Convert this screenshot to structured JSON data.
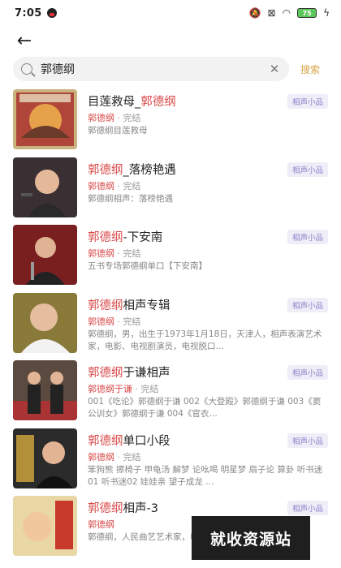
{
  "status": {
    "time": "7:05",
    "battery": "75"
  },
  "search": {
    "query": "郭德纲",
    "button_label": "搜索",
    "clear": "✕"
  },
  "results": [
    {
      "title_pre": "目莲救母_",
      "title_hl": "郭德纲",
      "title_post": "",
      "author": "郭德纲",
      "status": " · 完结",
      "desc": "郭德纲目莲救母",
      "tag": "相声小品"
    },
    {
      "title_pre": "",
      "title_hl": "郭德纲",
      "title_post": "_落榜艳遇",
      "author": "郭德纲",
      "status": " · 完结",
      "desc": "郭德纲相声：落榜艳遇",
      "tag": "相声小品"
    },
    {
      "title_pre": "",
      "title_hl": "郭德纲",
      "title_post": "-下安南",
      "author": "郭德纲",
      "status": " · 完结",
      "desc": "五书专场郭德纲单口【下安南】",
      "tag": "相声小品"
    },
    {
      "title_pre": "",
      "title_hl": "郭德纲",
      "title_post": "相声专辑",
      "author": "郭德纲",
      "status": " · 完结",
      "desc": "郭德纲，男，出生于1973年1月18日，天津人，相声表演艺术家，电影、电视剧演员，电视脱口…",
      "tag": "相声小品"
    },
    {
      "title_pre": "",
      "title_hl": "郭德纲",
      "title_post": "于谦相声",
      "author": "郭德纲于谦",
      "status": " · 完结",
      "desc": "001《吃论》郭德纲于谦 002《大登殿》郭德纲于谦 003《窦公训女》郭德纲于谦 004《官衣…",
      "tag": "相声小品"
    },
    {
      "title_pre": "",
      "title_hl": "郭德纲",
      "title_post": "单口小段",
      "author": "郭德纲",
      "status": " · 完结",
      "desc": "笨狗熊 擦椅子 甲龟汤 解梦 论吆喝 明星梦 扇子论 算卦 听书迷01 听书迷02 娃娃亲 望子成龙 …",
      "tag": "相声小品"
    },
    {
      "title_pre": "",
      "title_hl": "郭德纲",
      "title_post": "相声-3",
      "author": "郭德纲",
      "status": "",
      "desc": "郭德纲，人民曲艺艺术家，电视脱口秀主持人…",
      "tag": "相声小品"
    }
  ],
  "watermark": "就收资源站",
  "colors": {
    "accent": "#d94a4a",
    "search_button": "#d8a54a",
    "tag_bg": "#efedf8",
    "tag_text": "#8c82c8"
  }
}
